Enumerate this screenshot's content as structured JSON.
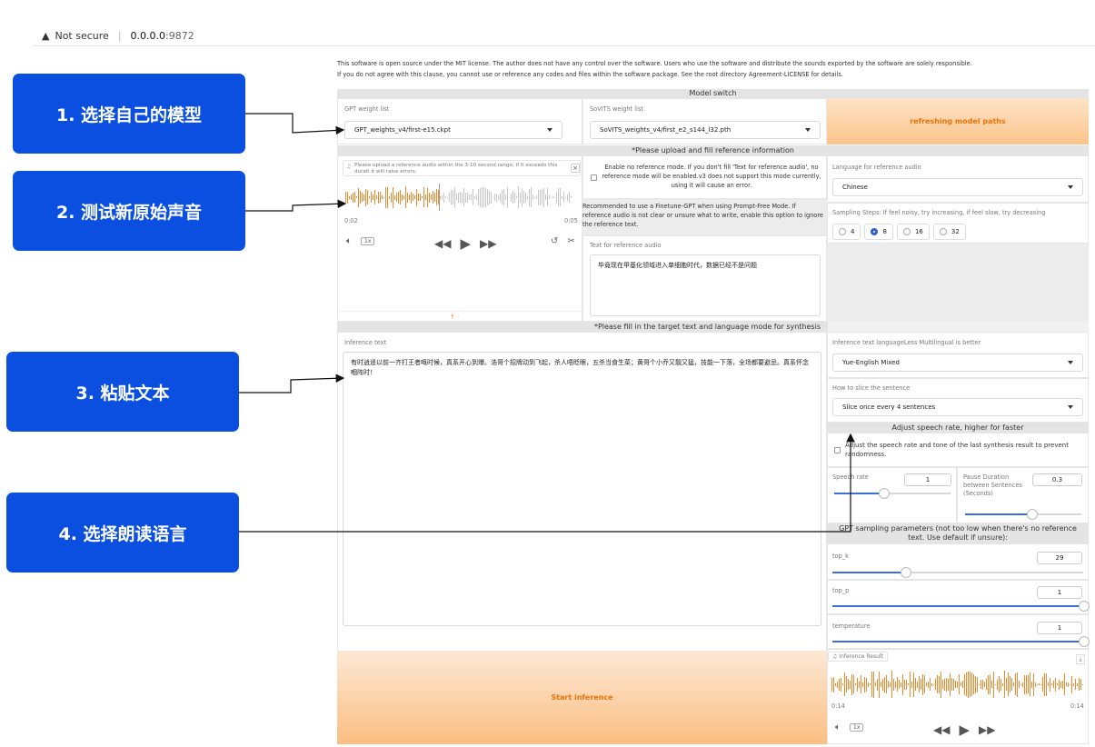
{
  "browser": {
    "security": "Not secure",
    "host": "0.0.0.0",
    "port": ":9872"
  },
  "license": {
    "line1": "This software is open source under the MIT license. The author does not have any control over the software. Users who use the software and distribute the sounds exported by the software are solely responsible.",
    "line2": "If you do not agree with this clause, you cannot use or reference any codes and files within the software package. See the root directory Agreement-LICENSE for details."
  },
  "model_switch": {
    "header": "Model switch",
    "gpt_label": "GPT weight list",
    "gpt_value": "GPT_weights_v4/first-e15.ckpt",
    "sovits_label": "SoVITS weight list",
    "sovits_value": "SoVITS_weights_v4/first_e2_s144_l32.pth",
    "refresh": "refreshing model paths"
  },
  "reference": {
    "header": "*Please upload and fill reference information",
    "audio_hint": "Please upload a reference audio within the 3-10 second range; if it exceeds this durati it will raise errors.",
    "time_start": "0:02",
    "time_end": "0:05",
    "speed": "1x",
    "no_ref_text": "Enable no reference mode. If you don't fill 'Text for reference audio', no reference mode will be enabled.v3 does not support this mode currently, using it will cause an error.",
    "recommend": "Recommended to use a Finetune-GPT when using Prompt-Free Mode. If reference audio is not clear or unsure what to write, enable this option to ignore the reference text.",
    "ref_text_label": "Text for reference audio",
    "ref_text_value": "毕竟现在甲基化领域进入单细胞时代，数据已经不是问题",
    "lang_label": "Language for reference audio",
    "lang_value": "Chinese",
    "steps_label": "Sampling Steps: If feel noisy, try increasing, if feel slow, try decreasing",
    "steps": [
      "4",
      "8",
      "16",
      "32"
    ],
    "steps_selected": "8"
  },
  "synthesis": {
    "header": "*Please fill in the target text and language mode for synthesis",
    "inference_label": "Inference text",
    "inference_value": "有时逍遥以前一齐打王者嘅时候，真系开心到爆。浩哥个招牌动到飞起，杀人唔眨眼，五杀当食生菜；黄哥个小乔又靓又猛，技能一下落，全场都要避忌。真系怀念嗰阵时！",
    "lang_label": "Inference text languageLess Multilingual is better",
    "lang_value": "Yue-English Mixed",
    "slice_label": "How to slice the sentence",
    "slice_value": "Slice once every 4 sentences",
    "speed_header": "Adjust speech rate, higher for faster",
    "speed_check": "Adjust the speech rate and tone of the last synthesis result to prevent randomness.",
    "speech_rate_label": "Speech rate",
    "speech_rate": "1",
    "pause_label": "Pause Duration between Sentences (Seconds)",
    "pause": "0.3",
    "gpt_header": "GPT sampling parameters (not too low when there's no reference text. Use default if unsure):",
    "top_k_label": "top_k",
    "top_k": "29",
    "top_p_label": "top_p",
    "top_p": "1",
    "temp_label": "temperature",
    "temp": "1",
    "start": "Start inference",
    "result_label": "Inference Result",
    "result_t1": "0:14",
    "result_t2": "0:14",
    "result_speed": "1x"
  },
  "callouts": [
    "1. 选择自己的模型",
    "2. 测试新原始声音",
    "3. 粘贴文本",
    "4. 选择朗读语言"
  ],
  "colors": {
    "callout": "#0a4fe0",
    "accent": "#e8740c",
    "slider": "#3b6fd8",
    "wave": "#f08a2c"
  }
}
